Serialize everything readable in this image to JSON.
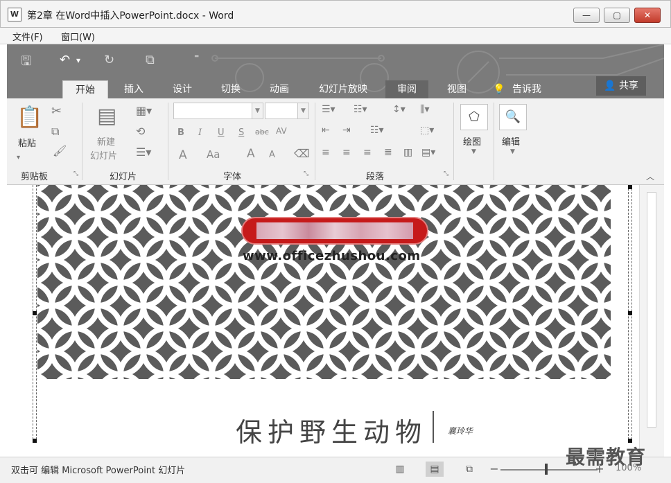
{
  "window": {
    "icon_letter": "W",
    "title": "第2章  在Word中插入PowerPoint.docx - Word",
    "minimize_glyph": "—",
    "maximize_glyph": "▢",
    "close_glyph": "✕"
  },
  "menubar": {
    "items": [
      "文件(F)",
      "窗口(W)"
    ]
  },
  "quick_access": {
    "save": "🖫",
    "undo": "↶",
    "undo_more": "▾",
    "redo": "↻",
    "touch": "⧉",
    "customize": "⁼"
  },
  "tabs": [
    "开始",
    "插入",
    "设计",
    "切换",
    "动画",
    "幻灯片放映",
    "审阅",
    "视图"
  ],
  "tell_me": "告诉我",
  "share": "共享",
  "ribbon": {
    "clipboard": {
      "paste_label": "粘贴",
      "group_label": "剪贴板"
    },
    "slides": {
      "new_slide_line1": "新建",
      "new_slide_line2": "幻灯片",
      "group_label": "幻灯片"
    },
    "font": {
      "group_label": "字体",
      "bold": "B",
      "italic": "I",
      "underline": "U",
      "shadow": "S",
      "strike": "abc",
      "spacing": "AV",
      "grow": "A",
      "shrink": "A",
      "size_cycle": "Aa",
      "font_color": "A"
    },
    "paragraph": {
      "group_label": "段落"
    },
    "drawing": {
      "label": "绘图"
    },
    "editing": {
      "label": "编辑"
    }
  },
  "document": {
    "watermark": "www.officezhushou.com",
    "heading": "保护野生动物",
    "signature": "襄玲华"
  },
  "status": {
    "text": "双击可 编辑 Microsoft PowerPoint 幻灯片",
    "zoom_minus": "−",
    "zoom_plus": "+",
    "zoom": "100%"
  },
  "branding": {
    "logo": "最需教育"
  },
  "colors": {
    "ribbon_dark": "#7b7b7b",
    "pattern_dark": "#5b5b5b",
    "accent_red": "#c61a1a"
  }
}
